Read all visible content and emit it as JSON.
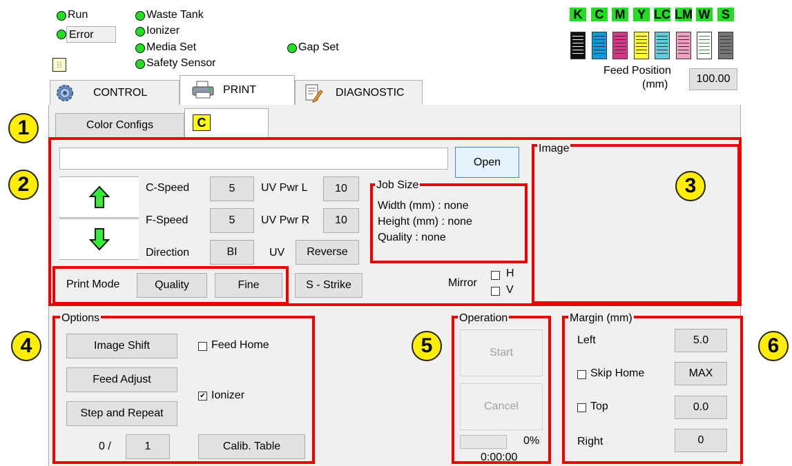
{
  "status": {
    "run": "Run",
    "error": "Error",
    "waste_tank": "Waste Tank",
    "ionizer": "Ionizer",
    "media_set": "Media Set",
    "safety_sensor": "Safety Sensor",
    "gap_set": "Gap Set",
    "small_box": "B"
  },
  "cartridges": [
    {
      "label": "K",
      "color": "#111111"
    },
    {
      "label": "C",
      "color": "#0a9dd9"
    },
    {
      "label": "M",
      "color": "#d6388a"
    },
    {
      "label": "Y",
      "color": "#ffff33"
    },
    {
      "label": "LC",
      "color": "#66ccdd"
    },
    {
      "label": "LM",
      "color": "#f0a0c0"
    },
    {
      "label": "W",
      "color": "#ffffff"
    },
    {
      "label": "S",
      "color": "#777777"
    }
  ],
  "feed_position": {
    "label_line1": "Feed Position",
    "label_line2": "(mm)",
    "value": "100.00"
  },
  "tabs": {
    "control": "CONTROL",
    "print": "PRINT",
    "diagnostic": "DIAGNOSTIC"
  },
  "color_configs": {
    "button": "Color Configs",
    "selected": "C"
  },
  "open_button": "Open",
  "speed": {
    "c_speed_label": "C-Speed",
    "c_speed": "5",
    "f_speed_label": "F-Speed",
    "f_speed": "5",
    "direction_label": "Direction",
    "direction": "BI",
    "uv_pwr_l_label": "UV Pwr L",
    "uv_pwr_l": "10",
    "uv_pwr_r_label": "UV Pwr R",
    "uv_pwr_r": "10",
    "uv_label": "UV",
    "reverse": "Reverse"
  },
  "job_size": {
    "title": "Job Size",
    "width": "Width (mm) : none",
    "height": "Height (mm) : none",
    "quality": "Quality : none"
  },
  "image_title": "Image",
  "print_mode": {
    "label": "Print Mode",
    "quality": "Quality",
    "fine": "Fine",
    "strike": "S - Strike"
  },
  "mirror": {
    "label": "Mirror",
    "h": "H",
    "v": "V"
  },
  "options": {
    "title": "Options",
    "image_shift": "Image Shift",
    "feed_adjust": "Feed Adjust",
    "step_repeat": "Step and Repeat",
    "feed_home": "Feed Home",
    "ionizer": "Ionizer",
    "count_prefix": "0 /",
    "count": "1",
    "calib_table": "Calib. Table"
  },
  "operation": {
    "title": "Operation",
    "start": "Start",
    "cancel": "Cancel",
    "percent": "0%",
    "progress": 0,
    "time": "0:00:00"
  },
  "margin": {
    "title": "Margin (mm)",
    "left_label": "Left",
    "left": "5.0",
    "skip_home_label": "Skip Home",
    "skip_home": "MAX",
    "top_label": "Top",
    "top": "0.0",
    "right_label": "Right",
    "right": "0"
  },
  "badges": [
    "1",
    "2",
    "3",
    "4",
    "5",
    "6"
  ]
}
